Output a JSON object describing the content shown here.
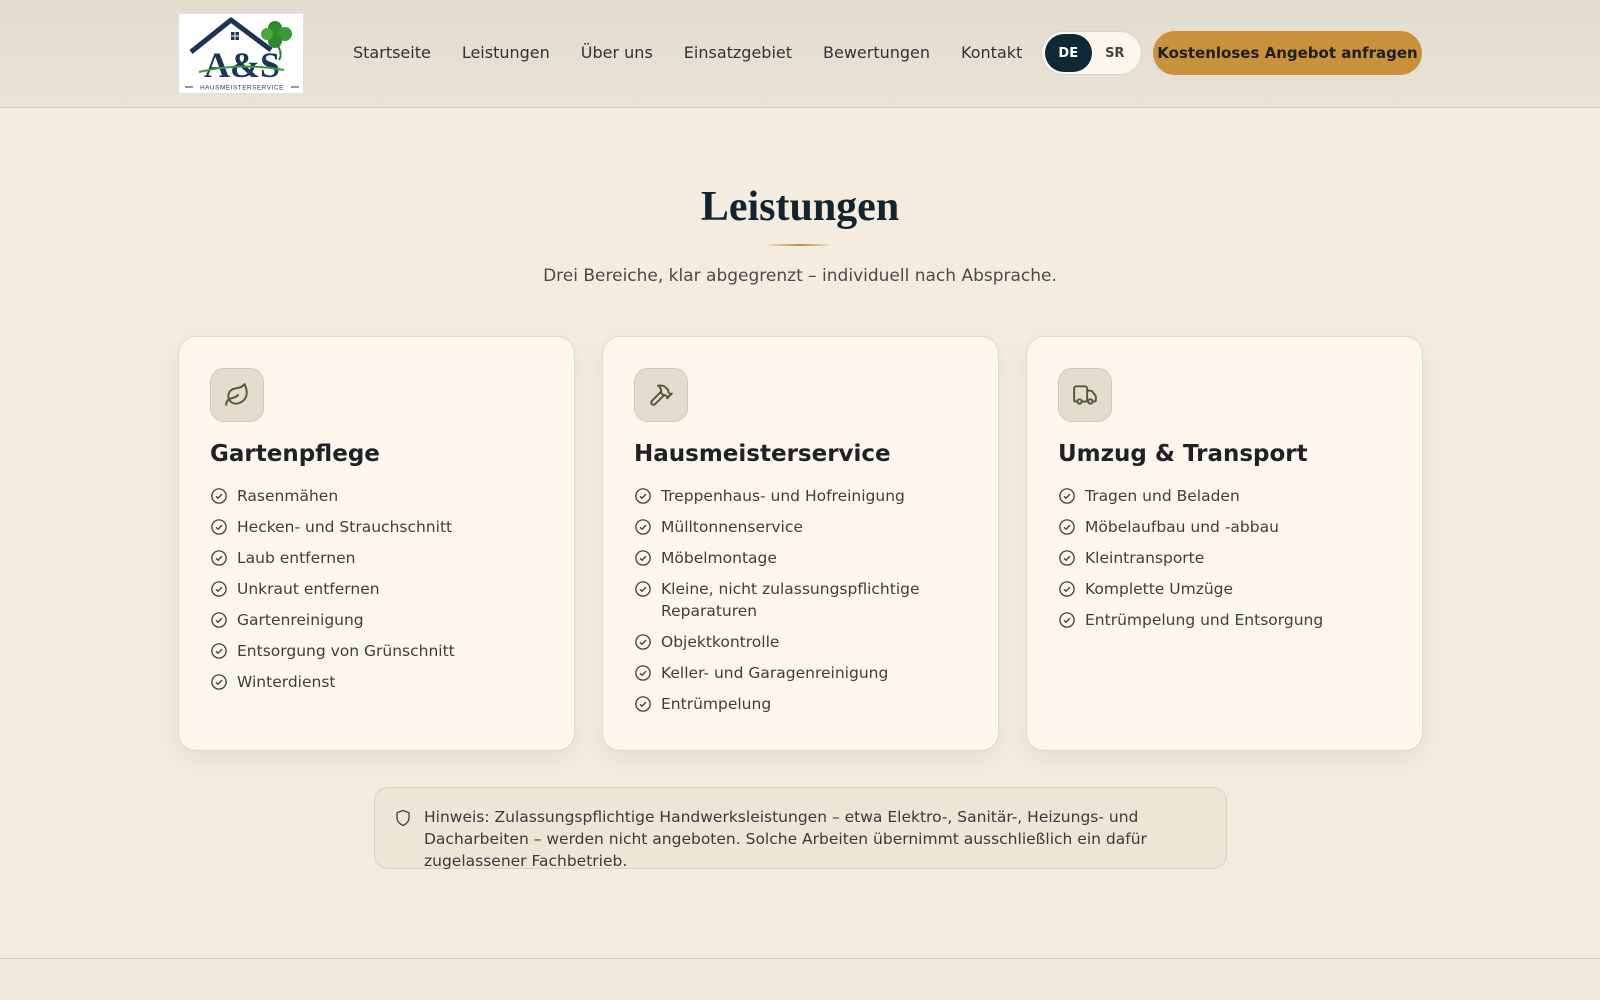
{
  "header": {
    "logo": {
      "text": "A&S",
      "tagline": "HAUSMEISTERSERVICE"
    },
    "nav": [
      {
        "label": "Startseite"
      },
      {
        "label": "Leistungen"
      },
      {
        "label": "Über uns"
      },
      {
        "label": "Einsatzgebiet"
      },
      {
        "label": "Bewertungen"
      },
      {
        "label": "Kontakt"
      }
    ],
    "languages": [
      {
        "code": "DE",
        "active": true
      },
      {
        "code": "SR",
        "active": false
      }
    ],
    "cta_label": "Kostenloses Angebot anfragen"
  },
  "section": {
    "title": "Leistungen",
    "subtitle": "Drei Bereiche, klar abgegrenzt – individuell nach Absprache."
  },
  "cards": [
    {
      "icon": "leaf-icon",
      "title": "Gartenpflege",
      "items": [
        "Rasenmähen",
        "Hecken- und Strauchschnitt",
        "Laub entfernen",
        "Unkraut entfernen",
        "Gartenreinigung",
        "Entsorgung von Grünschnitt",
        "Winterdienst"
      ]
    },
    {
      "icon": "hammer-icon",
      "title": "Hausmeisterservice",
      "items": [
        "Treppenhaus- und Hofreinigung",
        "Mülltonnenservice",
        "Möbelmontage",
        "Kleine, nicht zulassungspflichtige Reparaturen",
        "Objektkontrolle",
        "Keller- und Garagenreinigung",
        "Entrümpelung"
      ]
    },
    {
      "icon": "truck-icon",
      "title": "Umzug & Transport",
      "items": [
        "Tragen und Beladen",
        "Möbelaufbau und -abbau",
        "Kleintransporte",
        "Komplette Umzüge",
        "Entrümpelung und Entsorgung"
      ]
    }
  ],
  "notice": {
    "icon": "shield-icon",
    "text": "Hinweis: Zulassungspflichtige Handwerksleistungen – etwa Elektro-, Sanitär-, Heizungs- und Dacharbeiten – werden nicht angeboten. Solche Arbeiten übernimmt ausschließlich ein dafür zugelassener Fachbetrieb."
  },
  "colors": {
    "background": "#f5ece0",
    "navy": "#0f2a36",
    "accent": "#c8913a",
    "card": "#fcf6ec"
  }
}
